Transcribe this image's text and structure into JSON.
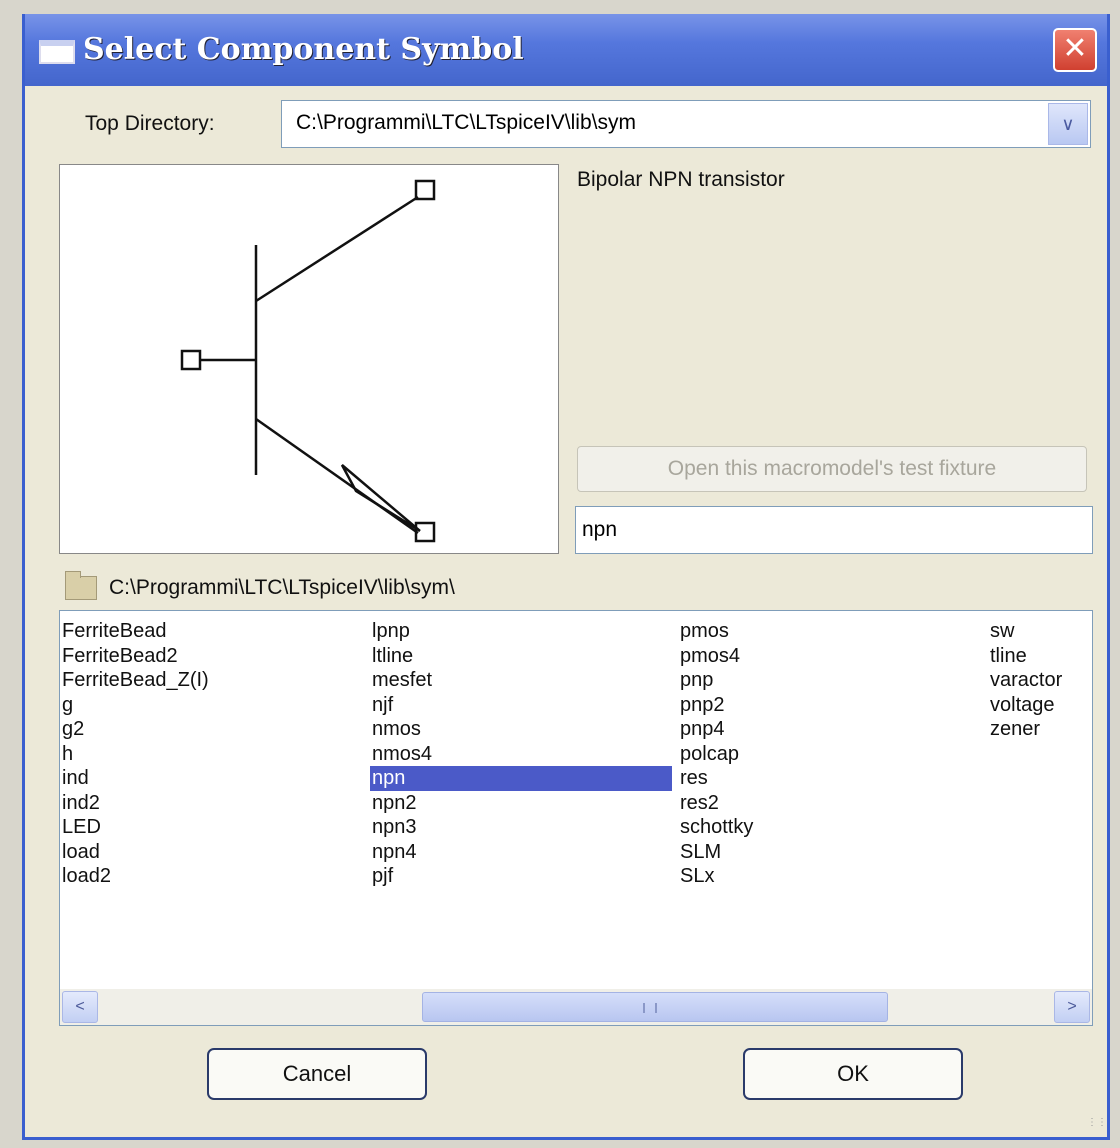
{
  "window": {
    "title": "Select Component Symbol",
    "close_glyph": "✕"
  },
  "top_directory": {
    "label": "Top Directory:",
    "value": "C:\\Programmi\\LTC\\LTspiceIV\\lib\\sym"
  },
  "preview": {
    "symbol": "npn",
    "description": "Bipolar NPN transistor"
  },
  "fixture_button": {
    "label": "Open this macromodel's test fixture",
    "enabled": false
  },
  "search": {
    "value": "npn"
  },
  "current_path": "C:\\Programmi\\LTC\\LTspiceIV\\lib\\sym\\",
  "symbol_list": {
    "selected": "npn",
    "columns": [
      [
        "FerriteBead",
        "FerriteBead2",
        "FerriteBead_Z(I)",
        "g",
        "g2",
        "h",
        "ind",
        "ind2",
        "LED",
        "load",
        "load2"
      ],
      [
        "lpnp",
        "ltline",
        "mesfet",
        "njf",
        "nmos",
        "nmos4",
        "npn",
        "npn2",
        "npn3",
        "npn4",
        "pjf"
      ],
      [
        "pmos",
        "pmos4",
        "pnp",
        "pnp2",
        "pnp4",
        "polcap",
        "res",
        "res2",
        "schottky",
        "SLM",
        "SLx"
      ],
      [
        "sw",
        "tline",
        "varactor",
        "voltage",
        "zener"
      ]
    ]
  },
  "scrollbar": {
    "left_glyph": "<",
    "right_glyph": ">"
  },
  "buttons": {
    "cancel": "Cancel",
    "ok": "OK"
  }
}
